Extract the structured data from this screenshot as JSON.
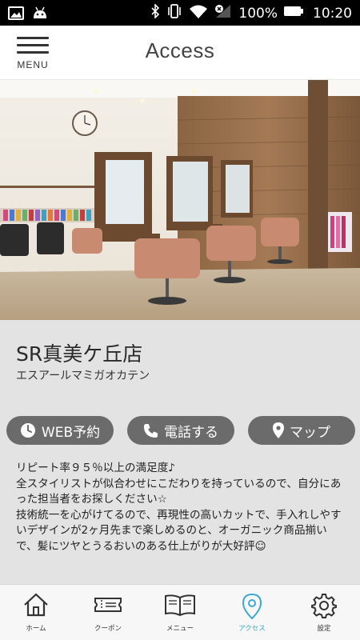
{
  "status_bar": {
    "battery_percent": "100%",
    "time": "10:20",
    "icons": [
      "image-icon",
      "android-icon",
      "bluetooth-icon",
      "vibrate-icon",
      "wifi-icon",
      "signal-off-icon",
      "battery-icon"
    ]
  },
  "header": {
    "menu_label": "MENU",
    "title": "Access"
  },
  "shop": {
    "name": "SR真美ケ丘店",
    "kana": "エスアールマミガオカテン",
    "photo_alt": "salon interior"
  },
  "actions": [
    {
      "label": "WEB予約",
      "icon": "clock-icon"
    },
    {
      "label": "電話する",
      "icon": "phone-icon"
    },
    {
      "label": "マップ",
      "icon": "map-pin-icon"
    }
  ],
  "description": [
    "リピート率９５％以上の満足度♪",
    "全スタイリストが似合わせにこだわりを持っているので、自分にあった担当者をお探しください☆",
    "技術統一を心がけてるので、再現性の高いカットで、手入れしやすいデザインが2ヶ月先まで楽しめるのと、オーガニック商品揃いで、髪にツヤとうるおいのある仕上がりが大好評☺"
  ],
  "tabbar": {
    "items": [
      {
        "label": "ホーム",
        "icon": "home-icon",
        "active": false
      },
      {
        "label": "クーポン",
        "icon": "ticket-icon",
        "active": false
      },
      {
        "label": "メニュー",
        "icon": "book-icon",
        "active": false
      },
      {
        "label": "アクセス",
        "icon": "map-pin-icon",
        "active": true
      },
      {
        "label": "設定",
        "icon": "gear-icon",
        "active": false
      }
    ]
  },
  "colors": {
    "button_bg": "#6b6b6b",
    "active_tab": "#3aa8d8",
    "info_bg": "#e3e3e3"
  }
}
